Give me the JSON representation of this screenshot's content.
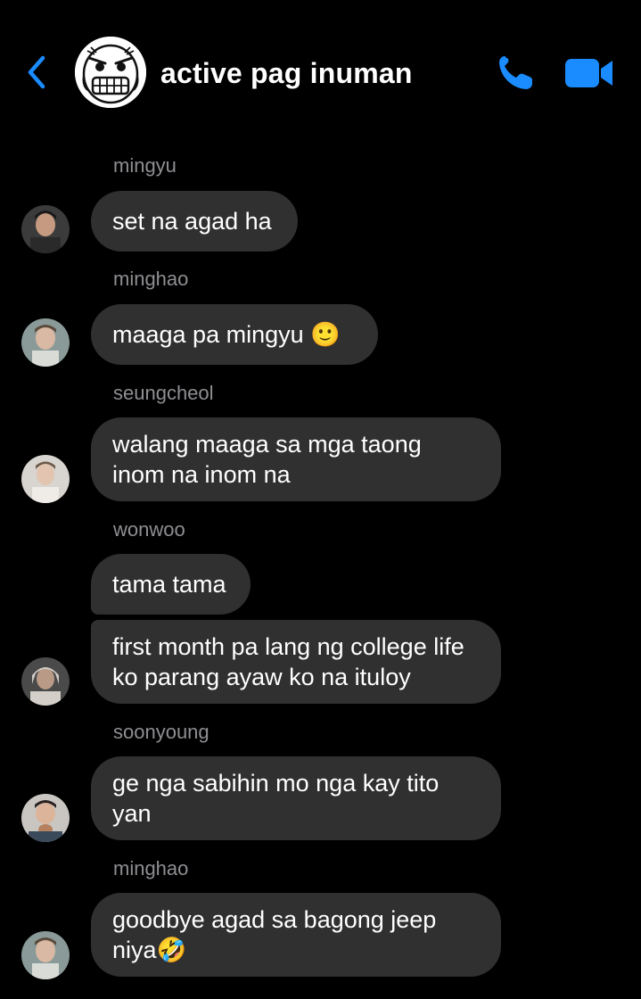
{
  "header": {
    "title": "active pag inuman",
    "back_icon": "chevron-left-icon",
    "call_icon": "phone-icon",
    "video_icon": "video-camera-icon",
    "accent_color": "#1a8cff"
  },
  "messages": [
    {
      "sender": "mingyu",
      "text": "set na agad ha"
    },
    {
      "sender": "minghao",
      "text": "maaga pa mingyu 🙂"
    },
    {
      "sender": "seungcheol",
      "text": "walang maaga sa mga taong inom na inom na"
    },
    {
      "sender": "wonwoo",
      "text": "tama tama"
    },
    {
      "sender": "",
      "text": "first month pa lang ng college life ko parang ayaw ko na ituloy"
    },
    {
      "sender": "soonyoung",
      "text": "ge nga sabihin mo nga kay tito yan"
    },
    {
      "sender": "minghao",
      "text": "goodbye agad sa bagong jeep niya🤣"
    }
  ],
  "colors": {
    "bubble": "#303030",
    "sender_name": "#8e8e93",
    "background": "#000000"
  }
}
